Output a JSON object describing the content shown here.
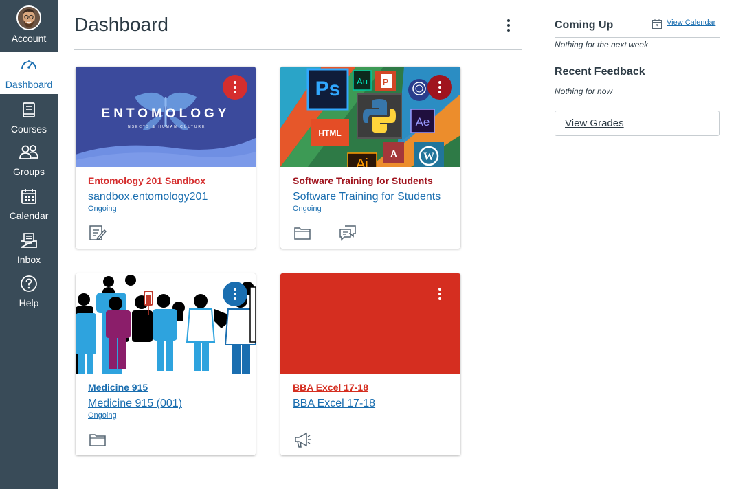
{
  "global_nav": {
    "items": [
      {
        "label": "Account",
        "icon": "avatar"
      },
      {
        "label": "Dashboard",
        "icon": "speedometer-icon"
      },
      {
        "label": "Courses",
        "icon": "book-icon"
      },
      {
        "label": "Groups",
        "icon": "people-icon"
      },
      {
        "label": "Calendar",
        "icon": "calendar-icon"
      },
      {
        "label": "Inbox",
        "icon": "inbox-icon"
      },
      {
        "label": "Help",
        "icon": "help-icon"
      }
    ],
    "background_color": "#394b58",
    "active_color": "#1a6eb0"
  },
  "header": {
    "title": "Dashboard"
  },
  "cards": [
    {
      "name": "Entomology 201 Sandbox",
      "code": "sandbox.entomology201",
      "term": "Ongoing",
      "hero_text": "ENTOMOLOGY",
      "hero_subtext": "INSECTS & HUMAN CULTURE",
      "color": "#d52e2e",
      "name_color": "#d52e2e",
      "actions": [
        "assignments-icon"
      ]
    },
    {
      "name": "Software Training for Students",
      "code": "Software Training for Students",
      "term": "Ongoing",
      "hero_tiles": [
        "Ps",
        "Au",
        "HTML",
        "Ae",
        "Ai"
      ],
      "color": "#a0141e",
      "name_color": "#a0141e",
      "actions": [
        "files-icon",
        "discussions-icon"
      ]
    },
    {
      "name": "Medicine 915",
      "code": "Medicine 915 (001)",
      "term": "Ongoing",
      "color": "#1a6eb0",
      "name_color": "#1a6eb0",
      "actions": [
        "files-icon"
      ]
    },
    {
      "name": "BBA Excel 17-18",
      "code": "BBA Excel 17-18",
      "term": "",
      "color": "#d52e20",
      "name_color": "#d52e20",
      "actions": [
        "announcements-icon"
      ]
    }
  ],
  "sidebar": {
    "coming_up": {
      "heading": "Coming Up",
      "link": "View Calendar",
      "calendar_day": "3",
      "empty_text": "Nothing for the next week"
    },
    "recent_feedback": {
      "heading": "Recent Feedback",
      "empty_text": "Nothing for now"
    },
    "view_grades_label": "View Grades"
  }
}
